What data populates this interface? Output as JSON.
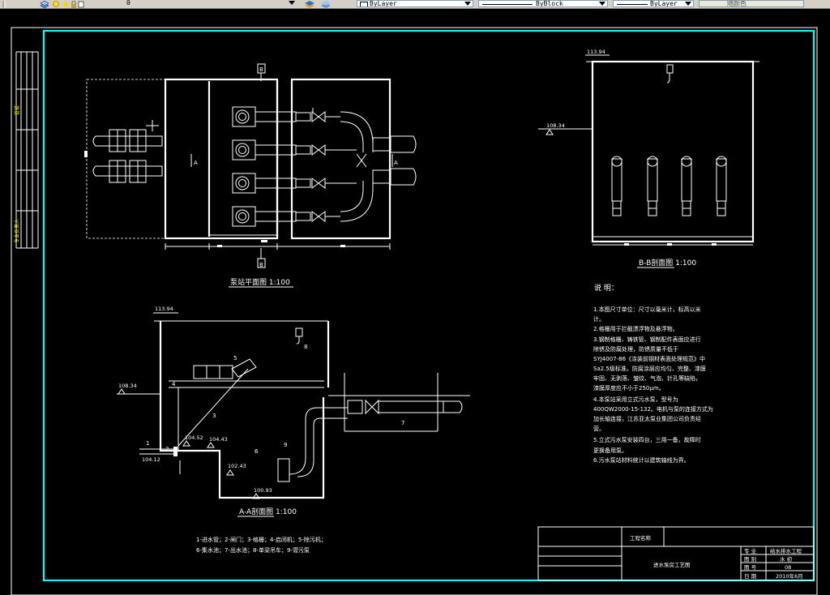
{
  "toolbar": {
    "layer_value": "0",
    "color_value": "ByLayer",
    "linetype_value": "ByBlock",
    "lineweight_value": "ByLayer",
    "plotstyle_value": "随颜色"
  },
  "drawing": {
    "plan_title": "泵站平面图 1:100",
    "section_bb_title": "B-B剖面图 1:100",
    "section_aa_title": "A-A剖面图 1:100",
    "marker_a": "A",
    "marker_b": "B",
    "elev_roof_bb": "113.94",
    "elev_ground_bb": "108.34",
    "elev_roof_aa": "113.94",
    "elev_ground_aa": "108.34",
    "elev_inlet_bottom": "104.12",
    "elev_104_52": "104.52",
    "elev_104_43": "104.43",
    "elev_102_43": "102.43",
    "elev_pit": "100.93",
    "callouts": [
      "1",
      "2",
      "3",
      "4",
      "5",
      "6",
      "7",
      "8",
      "9"
    ],
    "legend_line1": "1-进水管；2-闸门；3-格栅；4-启闭机；5-除污机；",
    "legend_line2": "6-集水池；7-出水池；8-单梁吊车；9-潜污泵",
    "notes_heading": "说  明：",
    "notes": [
      "1.本图尺寸单位：尺寸以毫米计，标高以米",
      "计。",
      "2.格栅用于拦截漂浮物及悬浮物。",
      "3.钢制格栅、铸铁管、钢制配件表面应进行",
      "除锈及防腐处理，防锈质量不低于",
      "SYJ4007-86《涂装前钢材表面处理规范》中",
      "Sa2.5级标准。防腐涂层应均匀、完整、漆膜",
      "牢固、无剥落、皱纹、气泡、针孔等缺陷，",
      "漆膜厚度应不小于250μm。",
      "4.本泵站采用立式污水泵，型号为",
      "400QW2000-15-132。电机与泵的连接方式为",
      "加长轴连接，江苏亚太泵业集团公司负责经",
      "营。",
      "5.立式污水泵安装四台，三用一备，故障时",
      "更换备用泵。",
      "6.污水泵站材料统计以建筑轴线为界。"
    ],
    "left_strip_top": "管道",
    "left_strip_bottom": "专业负责人",
    "titleblock": {
      "project_label": "工程名称",
      "drawing_name": "进水泵房工艺图",
      "rows": [
        {
          "label": "专  业",
          "value": "给水排水工程"
        },
        {
          "label": "图  别",
          "value": "水  初"
        },
        {
          "label": "图  号",
          "value": "08"
        },
        {
          "label": "日  期",
          "value": "2010年6月"
        }
      ]
    }
  }
}
